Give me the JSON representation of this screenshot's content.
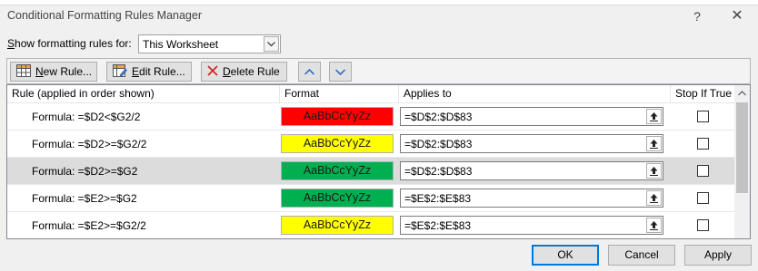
{
  "window": {
    "title": "Conditional Formatting Rules Manager",
    "help_glyph": "?",
    "close_glyph": "✕"
  },
  "show_rules": {
    "label_prefix": "S",
    "label_rest": "how formatting rules for:",
    "selected": "This Worksheet"
  },
  "toolbar": {
    "new_rule": {
      "u": "N",
      "rest": "ew Rule..."
    },
    "edit_rule": {
      "u": "E",
      "rest": "dit Rule..."
    },
    "delete_rule": {
      "u": "D",
      "rest": "elete Rule"
    },
    "move_up_icon": "chevron-up-icon",
    "move_down_icon": "chevron-down-icon"
  },
  "columns": {
    "rule": "Rule (applied in order shown)",
    "format": "Format",
    "applies_to": "Applies to",
    "stop_if_true": "Stop If True"
  },
  "rules": [
    {
      "formula": "Formula: =$D2<$G2/2",
      "preview": "AaBbCcYyZz",
      "bg": "#ff0000",
      "fg": "#1a1a1a",
      "applies_to": "=$D$2:$D$83",
      "stop_if_true": false,
      "selected": false
    },
    {
      "formula": "Formula: =$D2>=$G2/2",
      "preview": "AaBbCcYyZz",
      "bg": "#ffff00",
      "fg": "#1a1a1a",
      "applies_to": "=$D$2:$D$83",
      "stop_if_true": false,
      "selected": false
    },
    {
      "formula": "Formula: =$D2>=$G2",
      "preview": "AaBbCcYyZz",
      "bg": "#00b050",
      "fg": "#1a1a1a",
      "applies_to": "=$D$2:$D$83",
      "stop_if_true": false,
      "selected": true
    },
    {
      "formula": "Formula: =$E2>=$G2",
      "preview": "AaBbCcYyZz",
      "bg": "#00b050",
      "fg": "#1a1a1a",
      "applies_to": "=$E$2:$E$83",
      "stop_if_true": false,
      "selected": false
    },
    {
      "formula": "Formula: =$E2>=$G2/2",
      "preview": "AaBbCcYyZz",
      "bg": "#ffff00",
      "fg": "#1a1a1a",
      "applies_to": "=$E$2:$E$83",
      "stop_if_true": false,
      "selected": false
    }
  ],
  "buttons": {
    "ok": "OK",
    "cancel": "Cancel",
    "apply": "Apply"
  }
}
